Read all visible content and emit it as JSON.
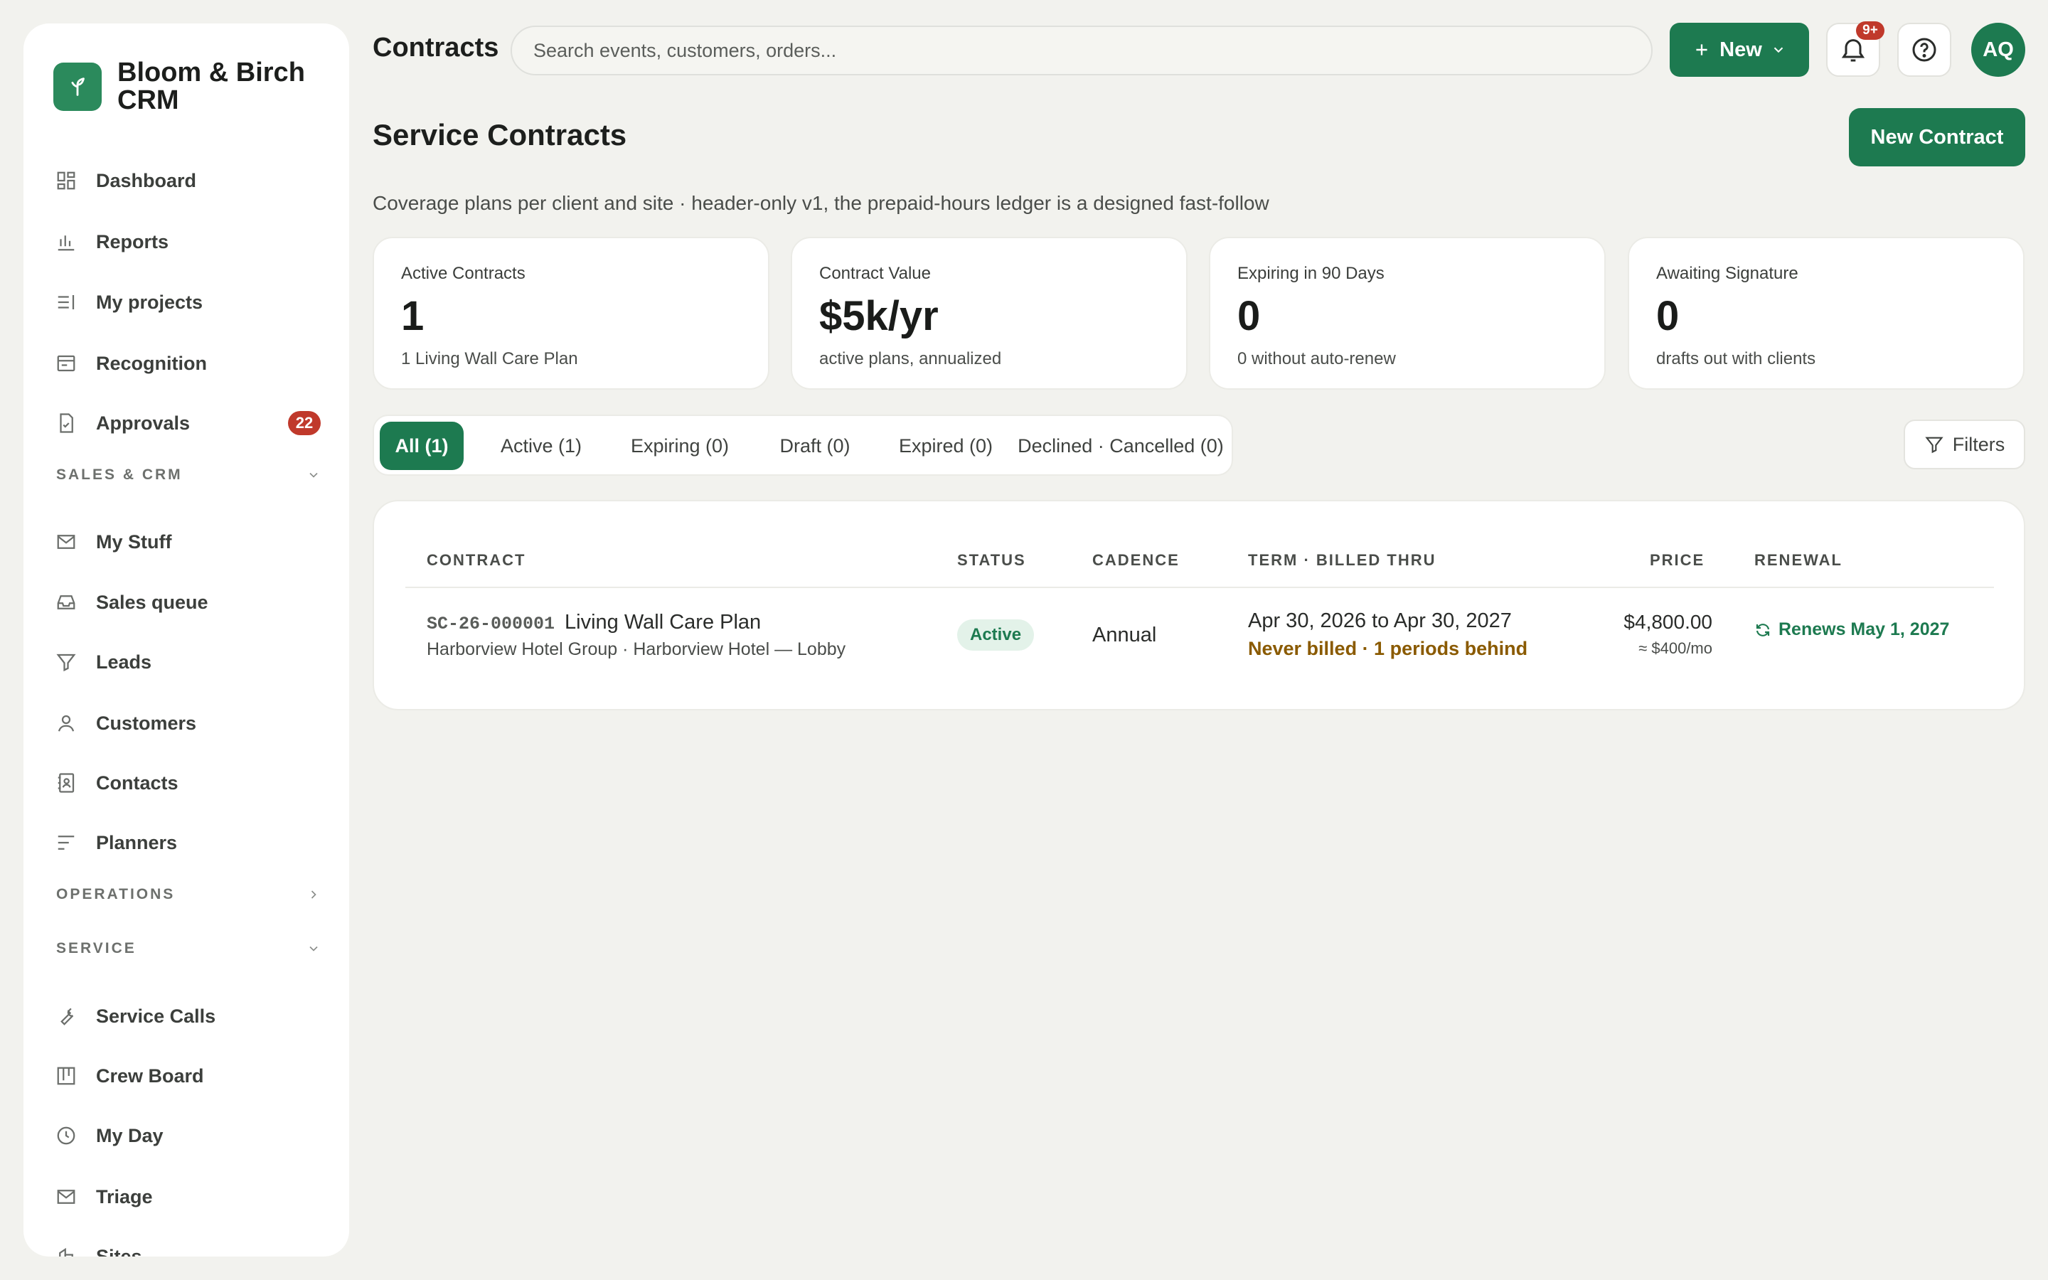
{
  "brand": {
    "name": "Bloom & Birch CRM"
  },
  "sidebar": {
    "items_top": [
      {
        "label": "Dashboard",
        "icon": "dashboard-icon"
      },
      {
        "label": "Reports",
        "icon": "bar-chart-icon"
      },
      {
        "label": "My projects",
        "icon": "list-icon"
      },
      {
        "label": "Recognition",
        "icon": "card-icon"
      },
      {
        "label": "Approvals",
        "icon": "document-check-icon",
        "badge": "22"
      }
    ],
    "sections": {
      "sales": "SALES & CRM",
      "operations": "OPERATIONS",
      "service": "SERVICE"
    },
    "items_sales": [
      {
        "label": "My Stuff",
        "icon": "mail-icon"
      },
      {
        "label": "Sales queue",
        "icon": "inbox-icon"
      },
      {
        "label": "Leads",
        "icon": "filter-icon"
      },
      {
        "label": "Customers",
        "icon": "person-icon"
      },
      {
        "label": "Contacts",
        "icon": "contact-book-icon"
      },
      {
        "label": "Planners",
        "icon": "lines-icon"
      }
    ],
    "items_service": [
      {
        "label": "Service Calls",
        "icon": "wrench-icon"
      },
      {
        "label": "Crew Board",
        "icon": "kanban-icon"
      },
      {
        "label": "My Day",
        "icon": "clock-icon"
      },
      {
        "label": "Triage",
        "icon": "mail-icon"
      },
      {
        "label": "Sites",
        "icon": "building-icon"
      }
    ]
  },
  "topbar": {
    "title": "Contracts",
    "search_placeholder": "Search events, customers, orders...",
    "new_label": "New",
    "notif_badge": "9+",
    "avatar_initials": "AQ"
  },
  "page": {
    "title": "Service Contracts",
    "new_contract_label": "New Contract",
    "subtitle": "Coverage plans per client and site · header-only v1, the prepaid-hours ledger is a designed fast-follow"
  },
  "kpis": [
    {
      "label": "Active Contracts",
      "value": "1",
      "sub": "1 Living Wall Care Plan"
    },
    {
      "label": "Contract Value",
      "value": "$5k/yr",
      "sub": "active plans, annualized"
    },
    {
      "label": "Expiring in 90 Days",
      "value": "0",
      "sub": "0 without auto-renew"
    },
    {
      "label": "Awaiting Signature",
      "value": "0",
      "sub": "drafts out with clients"
    }
  ],
  "tabs": [
    {
      "label": "All (1)",
      "active": true
    },
    {
      "label": "Active (1)"
    },
    {
      "label": "Expiring (0)"
    },
    {
      "label": "Draft (0)"
    },
    {
      "label": "Expired (0)"
    },
    {
      "label": "Declined · Cancelled (0)"
    }
  ],
  "filters_label": "Filters",
  "table": {
    "headers": {
      "contract": "CONTRACT",
      "status": "STATUS",
      "cadence": "CADENCE",
      "term": "TERM · BILLED THRU",
      "price": "PRICE",
      "renewal": "RENEWAL"
    },
    "rows": [
      {
        "id": "SC-26-000001",
        "name": "Living Wall Care Plan",
        "client": "Harborview Hotel Group · Harborview Hotel — Lobby",
        "status": "Active",
        "cadence": "Annual",
        "term": "Apr 30, 2026 to Apr 30, 2027",
        "billing": "Never billed · 1 periods behind",
        "price": "$4,800.00",
        "price_monthly": "≈ $400/mo",
        "renewal": "Renews May 1, 2027"
      }
    ]
  },
  "colors": {
    "accent": "#1d7a50",
    "badge": "#c0392b",
    "warning": "#8a5a00",
    "background": "#f2f2ee"
  }
}
